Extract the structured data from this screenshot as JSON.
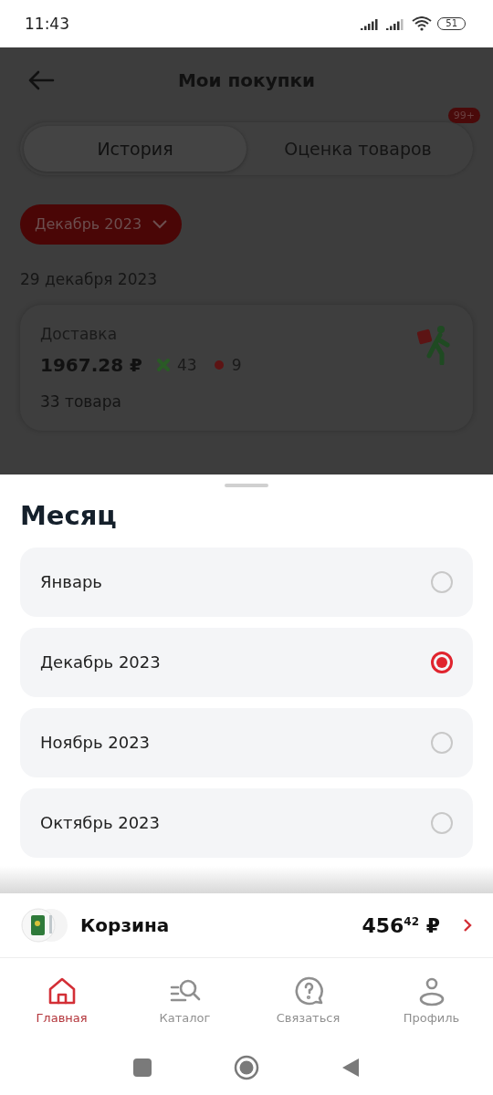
{
  "status_bar": {
    "time": "11:43",
    "battery": "51"
  },
  "header": {
    "title": "Мои покупки"
  },
  "tabs": [
    {
      "label": "История",
      "selected": true
    },
    {
      "label": "Оценка товаров",
      "selected": false,
      "badge": "99+"
    }
  ],
  "month_filter": {
    "label": "Декабрь 2023"
  },
  "orders": [
    {
      "date": "29 декабря 2023",
      "type": "Доставка",
      "total": "1967.28 ₽",
      "green_points": "43",
      "red_points": "9",
      "items": "33 товара"
    }
  ],
  "sheet": {
    "title": "Месяц",
    "options": [
      {
        "label": "Январь",
        "selected": false
      },
      {
        "label": "Декабрь 2023",
        "selected": true
      },
      {
        "label": "Ноябрь 2023",
        "selected": false
      },
      {
        "label": "Октябрь 2023",
        "selected": false
      }
    ]
  },
  "cart": {
    "label": "Корзина",
    "price": "456",
    "cents": "42",
    "currency": "₽"
  },
  "nav": [
    {
      "kind": "home",
      "label": "Главная",
      "selected": true
    },
    {
      "kind": "catalog",
      "label": "Каталог",
      "selected": false
    },
    {
      "kind": "contact",
      "label": "Связаться",
      "selected": false
    },
    {
      "kind": "profile",
      "label": "Профиль",
      "selected": false
    }
  ]
}
